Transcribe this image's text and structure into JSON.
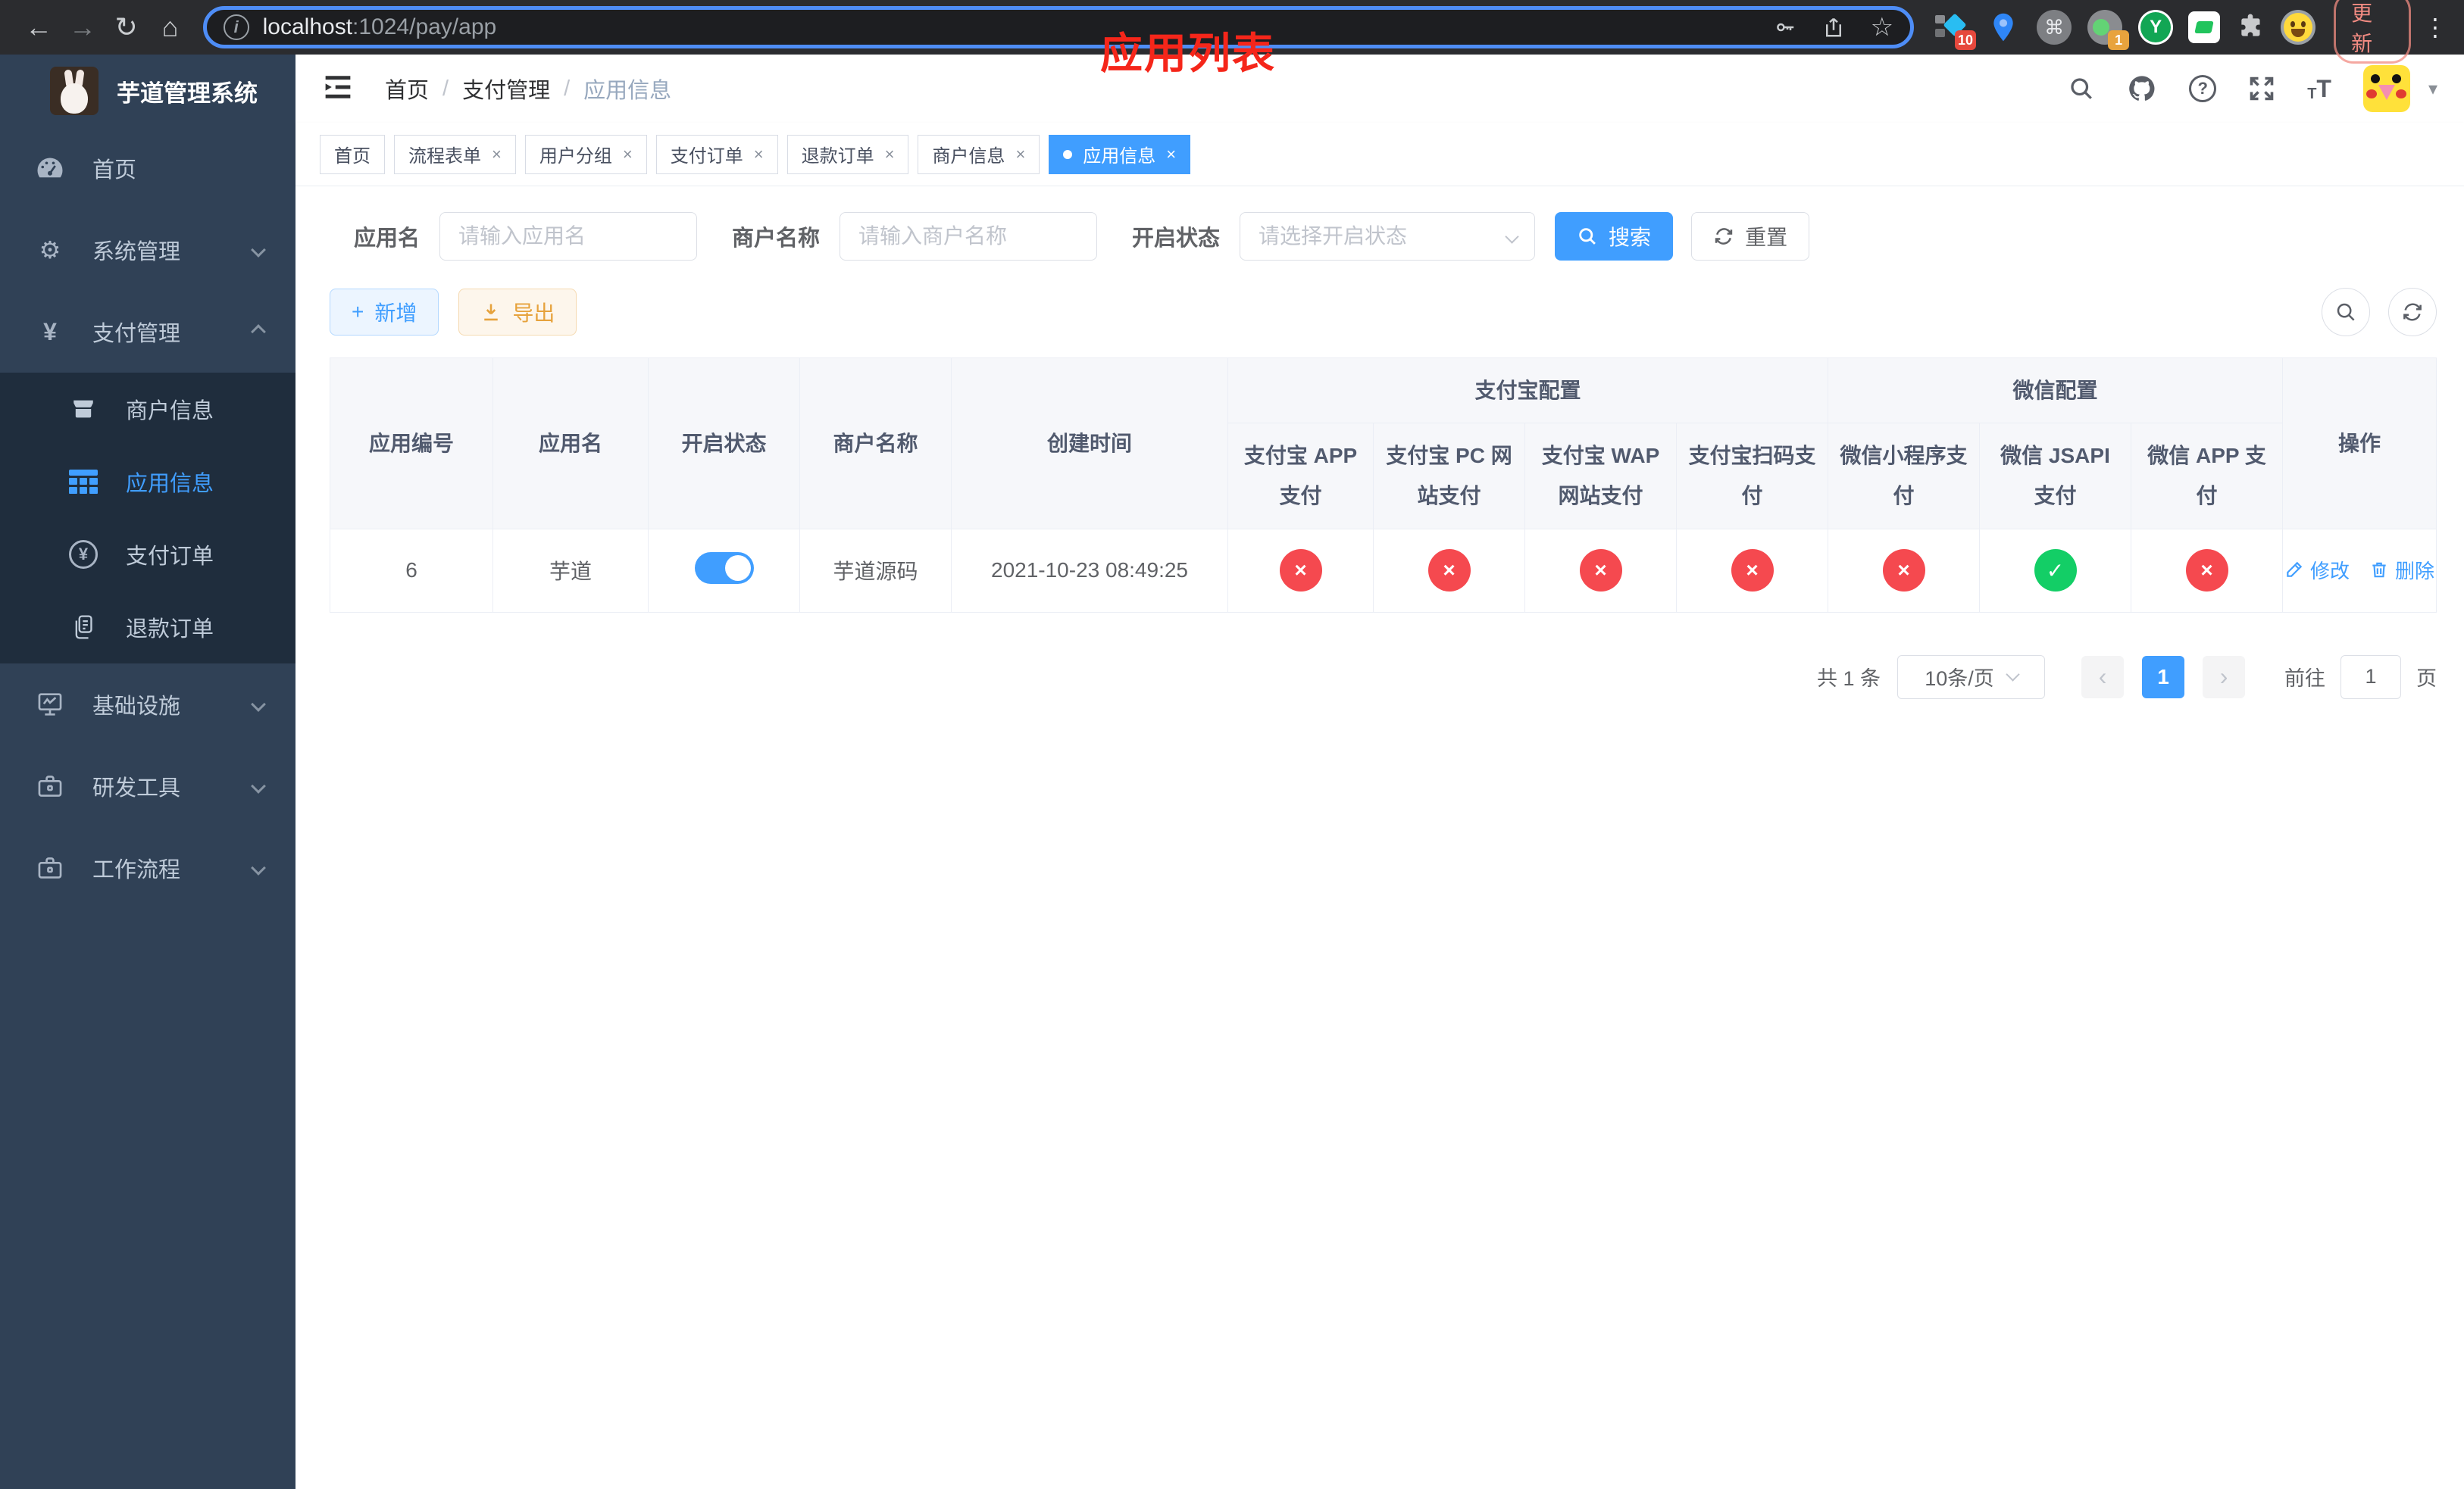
{
  "browser": {
    "url_host": "localhost",
    "url_path": ":1024/pay/app",
    "update_label": "更新",
    "ext_badge_a": "10",
    "ext_badge_b": "1",
    "ext_y_letter": "Y"
  },
  "icons": {
    "back": "←",
    "forward": "→",
    "reload": "↻",
    "home": "⌂",
    "star": "☆",
    "overflow": "⋮",
    "cmd": "⌘",
    "info": "i",
    "gear": "⚙",
    "yen": "¥",
    "question": "?",
    "close": "×",
    "check": "✓",
    "plus": "+",
    "prev": "‹",
    "next": "›",
    "caret": "▾",
    "t_small": "T",
    "t_big": "T"
  },
  "sidebar": {
    "title": "芋道管理系统",
    "menu": [
      {
        "label": "首页"
      },
      {
        "label": "系统管理"
      },
      {
        "label": "支付管理"
      },
      {
        "label": "基础设施"
      },
      {
        "label": "研发工具"
      },
      {
        "label": "工作流程"
      }
    ],
    "submenu": [
      {
        "label": "商户信息"
      },
      {
        "label": "应用信息"
      },
      {
        "label": "支付订单"
      },
      {
        "label": "退款订单"
      }
    ]
  },
  "breadcrumb": {
    "home": "首页",
    "separator": "/",
    "section": "支付管理",
    "current": "应用信息"
  },
  "annotation": "应用列表",
  "tabs": [
    {
      "label": "首页"
    },
    {
      "label": "流程表单"
    },
    {
      "label": "用户分组"
    },
    {
      "label": "支付订单"
    },
    {
      "label": "退款订单"
    },
    {
      "label": "商户信息"
    },
    {
      "label": "应用信息"
    }
  ],
  "filters": {
    "app_name_label": "应用名",
    "app_name_placeholder": "请输入应用名",
    "merchant_label": "商户名称",
    "merchant_placeholder": "请输入商户名称",
    "status_label": "开启状态",
    "status_placeholder": "请选择开启状态",
    "search_label": "搜索",
    "reset_label": "重置"
  },
  "toolbar": {
    "add_label": "新增",
    "export_label": "导出"
  },
  "table": {
    "col_app_id": "应用编号",
    "col_app_name": "应用名",
    "col_status": "开启状态",
    "col_merchant": "商户名称",
    "col_created": "创建时间",
    "group_alipay": "支付宝配置",
    "group_wechat": "微信配置",
    "col_actions": "操作",
    "sub_cols": [
      "支付宝 APP 支付",
      "支付宝 PC 网站支付",
      "支付宝 WAP 网站支付",
      "支付宝扫码支付",
      "微信小程序支付",
      "微信 JSAPI 支付",
      "微信 APP 支付"
    ],
    "row": {
      "id": "6",
      "name": "芋道",
      "enabled": true,
      "merchant": "芋道源码",
      "created": "2021-10-23 08:49:25",
      "pay_status": [
        "no",
        "no",
        "no",
        "no",
        "no",
        "yes",
        "no"
      ],
      "edit_label": "修改",
      "delete_label": "删除"
    }
  },
  "pagination": {
    "total": "共 1 条",
    "page_size": "10条/页",
    "current_page": "1",
    "goto_label": "前往",
    "goto_value": "1",
    "page_unit": "页"
  },
  "colors": {
    "primary": "#409eff",
    "success": "#13ce66",
    "danger": "#f5494f",
    "warning": "#e6a23c",
    "sidebar_bg": "#304156",
    "submenu_bg": "#1f2d3d",
    "annotation_red": "#f5261a"
  }
}
